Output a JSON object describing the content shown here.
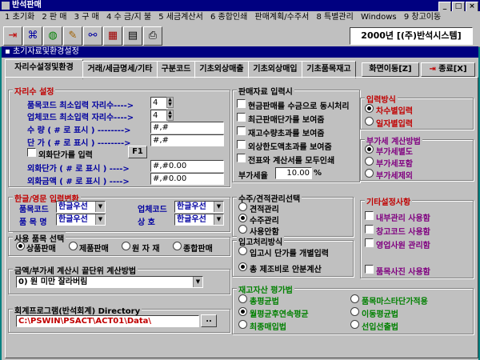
{
  "window": {
    "title": "반석판매"
  },
  "menu": [
    "1 초기화",
    "2 판 매",
    "3 구 매",
    "4 수 금/지 불",
    "5 세금계산서",
    "6 종합인쇄",
    "판매계획/수주서",
    "8 특별관리",
    "Windows",
    "9 창고이동"
  ],
  "toolbar": {
    "date_company": "2000년 [(주)반석시스템]"
  },
  "child_window": {
    "title": "초기자료및환경설정"
  },
  "tabs": [
    "자리수설정및환경",
    "거래/세금명세/기타",
    "구분코드",
    "기초외상매출",
    "기초외상매입",
    "기초품목재고"
  ],
  "buttons": {
    "screen_move": "화면이동[Z]",
    "close": "종료[X]",
    "f1": "F1",
    "browse": ".."
  },
  "digits": {
    "title": "자리수 설정",
    "item_code_label": "품목코드 최소입력 자리수---->",
    "item_code_value": "4",
    "biz_code_label": "업체코드 최소입력 자리수---->",
    "biz_code_value": "4",
    "qty_label": "수   량 ( # 로 표시 ) -------->",
    "qty_value": "#,#",
    "price_label": "단   가 ( # 로 표시 ) -------->",
    "price_value": "#,#",
    "foreign_price_check": "외화단가를 입력",
    "foreign_price_label": "외화단가 ( # 로 표시 ) ---->",
    "foreign_price_value": "#,#0.00",
    "foreign_amount_label": "외화금액 ( # 로 표시 ) ---->",
    "foreign_amount_value": "#,#0.00"
  },
  "input_conv": {
    "title": "한글/영문 입력변환",
    "item_code_label": "품목코드",
    "item_code_value": "한글우선",
    "biz_code_label": "업체코드",
    "biz_code_value": "한글우선",
    "item_name_label": "품 목 명",
    "item_name_value": "한글우선",
    "company_label": "상     호",
    "company_value": "한글우선"
  },
  "usage": {
    "title": "사용 품목 선택",
    "options": [
      "상품판매",
      "제품판매",
      "원 자 재",
      "종합판매"
    ],
    "selected": 0
  },
  "rounding": {
    "title": "금액/부가세 계산시 끝단위 계산방법",
    "value": "0) 원 미만 잘라버림"
  },
  "directory": {
    "title": "회계프로그램(반석회계) Directory",
    "value": "C:\\PSWIN\\PSACT\\ACT01\\Data\\"
  },
  "sales_input": {
    "title": "판매자료 입력시",
    "checks": [
      "현금판매를 수금으로 동시처리",
      "최근판매단가를 보여줌",
      "재고수량초과를 보여줌",
      "외상한도액초과를 보여줌",
      "전표와 계산서를 모두인쇄"
    ],
    "vat_rate_label": "부가세율",
    "vat_rate_value": "10.00",
    "vat_rate_unit": "%"
  },
  "input_method": {
    "title": "입력방식",
    "options": [
      "차수별입력",
      "일자별입력"
    ],
    "selected": 0
  },
  "vat_method": {
    "title": "부가세 계산방법",
    "options": [
      "부가세별도",
      "부가세포함",
      "부가세제외"
    ],
    "selected": 0
  },
  "order_mgmt": {
    "title": "수주/견적관리선택",
    "options": [
      "견적관리",
      "수주관리",
      "사용안함"
    ],
    "selected": 1
  },
  "receiving": {
    "title": "입고처리방식",
    "options": [
      "입고시 단가를 개별입력",
      "총 제조비로 안분계산"
    ],
    "selected": 1
  },
  "other_settings": {
    "title": "기타설정사항",
    "checks": [
      "내부관리 사용함",
      "창고코드 사용함",
      "영업사원 관리함",
      "품목사진 사용함"
    ]
  },
  "inventory_valuation": {
    "title": "재고자산 평가법",
    "options": [
      "총평균법",
      "품목마스타단가적용",
      "월평균후연속평균",
      "이동평균법",
      "최종매입법",
      "선입선출법"
    ],
    "selected": 2
  }
}
